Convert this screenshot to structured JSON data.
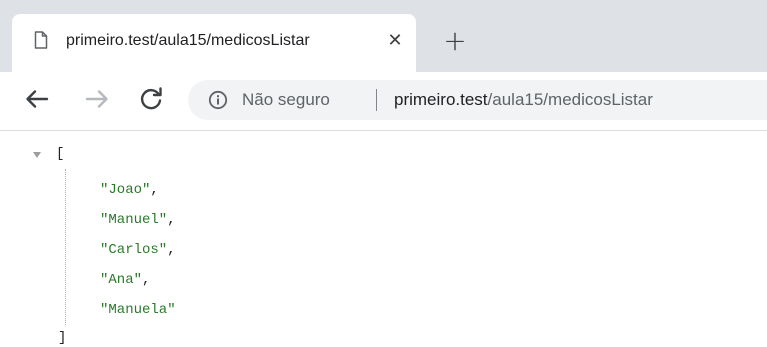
{
  "tab": {
    "title": "primeiro.test/aula15/medicosListar",
    "close_glyph": "✕",
    "page_icon": "page-icon"
  },
  "new_tab": {
    "glyph": "+"
  },
  "toolbar": {
    "back_icon": "arrow-left-icon",
    "forward_icon": "arrow-right-icon",
    "reload_icon": "reload-icon"
  },
  "omnibox": {
    "security_icon": "info-icon",
    "security_text": "Não seguro",
    "url_host": "primeiro.test",
    "url_path": "/aula15/medicosListar"
  },
  "json_view": {
    "open_bracket": "[",
    "close_bracket": "]",
    "items": [
      {
        "value": "\"Joao\"",
        "sep": ","
      },
      {
        "value": "\"Manuel\"",
        "sep": ","
      },
      {
        "value": "\"Carlos\"",
        "sep": ","
      },
      {
        "value": "\"Ana\"",
        "sep": ","
      },
      {
        "value": "\"Manuela\"",
        "sep": ""
      }
    ]
  },
  "colors": {
    "tabstrip_bg": "#dee1e6",
    "omnibox_bg": "#f1f3f4",
    "json_string": "#2a7a2a"
  }
}
